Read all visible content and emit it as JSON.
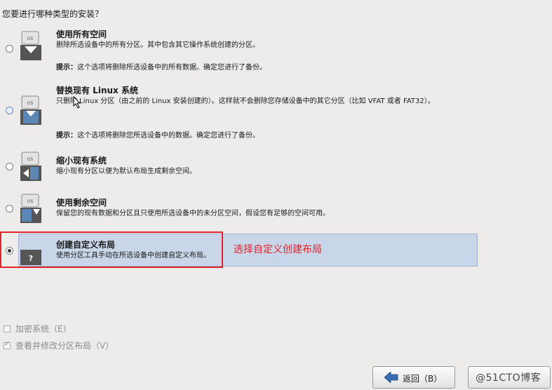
{
  "question": "您要进行哪种类型的安装？",
  "options": [
    {
      "title": "使用所有空间",
      "desc": "删除所选设备中的所有分区。其中包含其它操作系统创建的分区。",
      "tip_label": "提示：",
      "tip_text": "这个选项将删除所选设备中的所有数据。确定您进行了备份。",
      "disk_label": "OS"
    },
    {
      "title": "替换现有 Linux 系统",
      "desc": "只删除 Linux 分区（由之前的 Linux 安装创建的）。这样就不会删除您存储设备中的其它分区（比如 VFAT 或者 FAT32）。",
      "tip_label": "提示：",
      "tip_text": "这个选项将删除您所选设备中的数据。确定您进行了备份。",
      "disk_label": "OS"
    },
    {
      "title": "缩小现有系统",
      "desc": "缩小现有分区以便为默认布局生成剩余空间。",
      "disk_label": "OS"
    },
    {
      "title": "使用剩余空间",
      "desc": "保留您的现有数据和分区且只使用所选设备中的未分区空间，假设您有足够的空间可用。",
      "disk_label": "OS"
    },
    {
      "title": "创建自定义布局",
      "desc": "使用分区工具手动在所选设备中创建自定义布局。",
      "disk_label": "?",
      "selected": true
    }
  ],
  "annotation": "选择自定义创建布局",
  "checkboxes": [
    {
      "label": "加密系统（E）",
      "checked": false
    },
    {
      "label": "查看并修改分区布局（V）",
      "checked": true
    }
  ],
  "buttons": {
    "back_label": "返回（B）"
  },
  "watermark": "@51CTO博客",
  "colors": {
    "annotation": "#e0242a",
    "selected_bg": "#c9d5e8",
    "disk_blue": "#5a87b6"
  }
}
